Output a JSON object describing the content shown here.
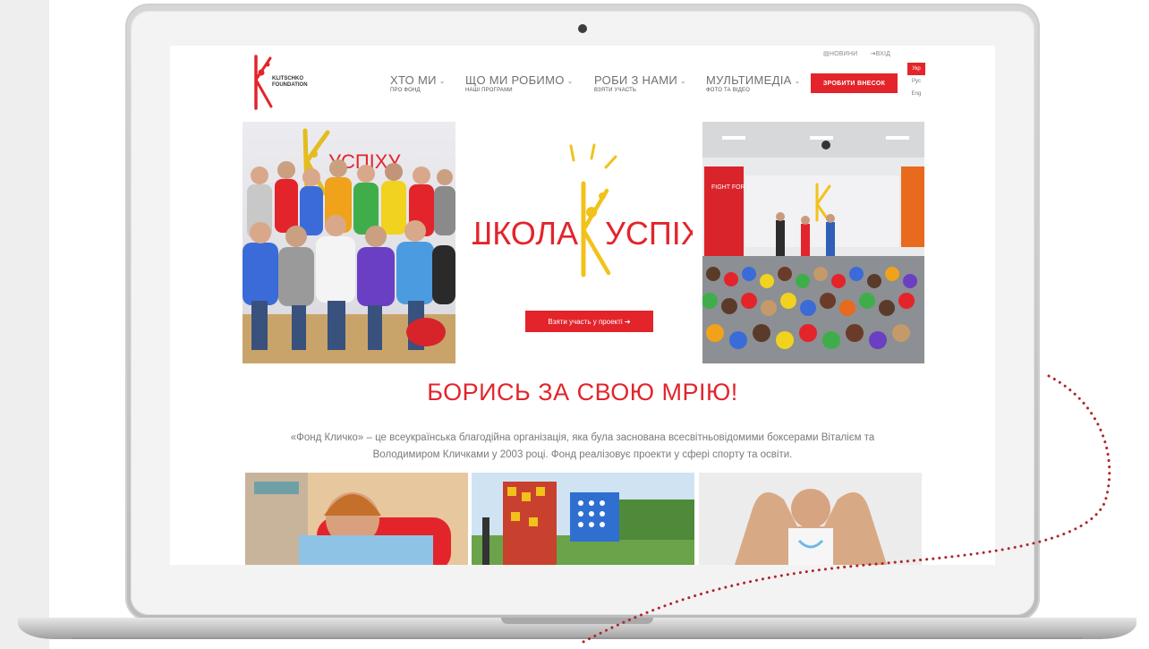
{
  "top_links": {
    "news": "НОВИНИ",
    "login": "ВХІД"
  },
  "logo_text": {
    "line1": "KLITSCHKO",
    "line2": "FOUNDATION"
  },
  "nav": [
    {
      "label": "ХТО МИ",
      "sub": "ПРО ФОНД"
    },
    {
      "label": "ЩО МИ РОБИМО",
      "sub": "НАШІ ПРОГРАМИ"
    },
    {
      "label": "РОБИ З НАМИ",
      "sub": "ВЗЯТИ УЧАСТЬ"
    },
    {
      "label": "МУЛЬТИМЕДІА",
      "sub": "ФОТО ТА ВІДЕО"
    }
  ],
  "donate_label": "ЗРОБИТИ ВНЕСОК",
  "languages": [
    "Укр",
    "Рус",
    "Eng"
  ],
  "hero": {
    "school_word1": "ШКОЛА",
    "school_word2": "УСПІХУ",
    "photo_left_text": "УСПІХУ",
    "cta": "Взяти участь у проекті ➔",
    "banner_text": "FIGHT FOR YOUR DREAM"
  },
  "slogan": "БОРИСЬ ЗА СВОЮ МРІЮ!",
  "description": "«Фонд Кличко» – це всеукраїнська благодійна організація, яка була заснована всесвітньовідомими боксерами Віталієм та Володимиром Кличками у 2003 році. Фонд реалізовує проекти у сфері спорту та освіти.",
  "colors": {
    "brand_red": "#e3242b",
    "annotation": "#b0252a"
  }
}
